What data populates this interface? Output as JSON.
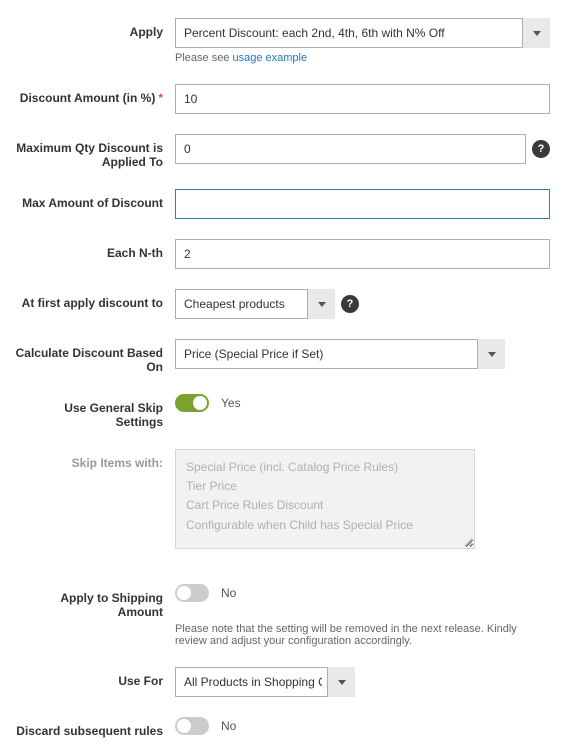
{
  "apply": {
    "label": "Apply",
    "value": "Percent Discount: each 2nd, 4th, 6th with N% Off",
    "hint_prefix": "Please see ",
    "hint_link": "usage example"
  },
  "discount_amount": {
    "label": "Discount Amount (in %)",
    "value": "10"
  },
  "max_qty": {
    "label": "Maximum Qty Discount is Applied To",
    "value": "0"
  },
  "max_amount": {
    "label": "Max Amount of Discount",
    "value": ""
  },
  "each_nth": {
    "label": "Each N-th",
    "value": "2"
  },
  "first_apply": {
    "label": "At first apply discount to",
    "value": "Cheapest products"
  },
  "calc_based": {
    "label": "Calculate Discount Based On",
    "value": "Price (Special Price if Set)"
  },
  "use_general_skip": {
    "label": "Use General Skip Settings",
    "value": "Yes"
  },
  "skip_items": {
    "label": "Skip Items with:",
    "opts": [
      "Special Price (incl. Catalog Price Rules)",
      "Tier Price",
      "Cart Price Rules Discount",
      "Configurable when Child has Special Price"
    ]
  },
  "apply_shipping": {
    "label": "Apply to Shipping Amount",
    "value": "No",
    "hint": "Please note that the setting will be removed in the next release. Kindly review and adjust your configuration accordingly."
  },
  "use_for": {
    "label": "Use For",
    "value": "All Products in Shopping Cart"
  },
  "discard": {
    "label": "Discard subsequent rules",
    "value": "No"
  }
}
